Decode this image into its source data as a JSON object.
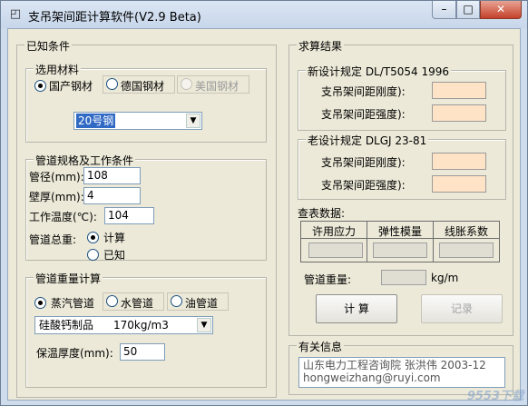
{
  "window": {
    "title": "支吊架间距计算软件(V2.9 Beta)",
    "controls": {
      "minimize": "–",
      "maximize": "□",
      "close": "✕"
    },
    "app_icon": "app-icon"
  },
  "known": {
    "label": "已知条件",
    "material": {
      "label": "选用材料",
      "options": [
        "国产钢材",
        "德国钢材",
        "美国钢材"
      ],
      "selected": "国产钢材",
      "grade": "20号钢"
    },
    "pipe": {
      "label": "管道规格及工作条件",
      "diameter_label": "管径(mm):",
      "diameter": "108",
      "wall_label": "壁厚(mm):",
      "wall": "4",
      "temp_label": "工作温度(℃):",
      "temp": "104",
      "weight_label": "管道总重:",
      "weight_options": [
        "计算",
        "已知"
      ],
      "weight_selected": "计算"
    },
    "weight_calc": {
      "label": "管道重量计算",
      "options": [
        "蒸汽管道",
        "水管道",
        "油管道"
      ],
      "selected": "蒸汽管道",
      "insulation_material": "硅酸钙制品",
      "insulation_density": "170kg/m3",
      "thickness_label": "保温厚度(mm):",
      "thickness": "50"
    }
  },
  "results": {
    "label": "求算结果",
    "new_spec": {
      "label": "新设计规定 DL/T5054 1996",
      "stiffness_label": "支吊架间距刚度):",
      "strength_label": "支吊架间距强度):"
    },
    "old_spec": {
      "label": "老设计规定 DLGJ 23-81",
      "stiffness_label": "支吊架间距刚度):",
      "strength_label": "支吊架间距强度):"
    },
    "table": {
      "label": "查表数据:",
      "headers": [
        "许用应力",
        "弹性模量",
        "线胀系数"
      ]
    },
    "weight_label": "管道重量:",
    "weight_unit": "kg/m",
    "calc_button": "计 算",
    "record_button": "记录"
  },
  "about": {
    "label": "有关信息",
    "line1": "山东电力工程咨询院 张洪伟  2003-12",
    "line2": "hongweizhang@ruyi.com"
  },
  "watermark": "9553下载"
}
